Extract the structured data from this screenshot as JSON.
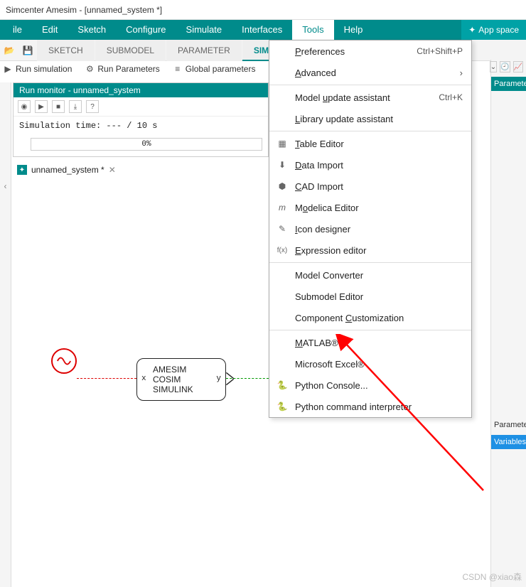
{
  "title": "Simcenter Amesim - [unnamed_system *]",
  "menubar": {
    "items": [
      "ile",
      "Edit",
      "Sketch",
      "Configure",
      "Simulate",
      "Interfaces",
      "Tools",
      "Help"
    ],
    "selected": "Tools",
    "app_space_label": "App space"
  },
  "toolbar": {
    "tabs": [
      "SKETCH",
      "SUBMODEL",
      "PARAMETER",
      "SIM"
    ],
    "active_tab": "SIM"
  },
  "subtoolbar": {
    "run_sim": "Run simulation",
    "run_params": "Run Parameters",
    "global_params": "Global parameters"
  },
  "right_panel": {
    "tab1": "Parameters",
    "tab_light": "Parameters",
    "tab_blue": "Variables"
  },
  "run_monitor": {
    "title": "Run monitor - unnamed_system",
    "sim_time": "Simulation time: --- / 10 s",
    "progress": "0%"
  },
  "document": {
    "name": "unnamed_system *",
    "close": "✕"
  },
  "block": {
    "port_in": "x",
    "port_out": "y",
    "line1": "AMESIM",
    "line2": "COSIM",
    "line3": "SIMULINK"
  },
  "tools_menu": {
    "preferences": "Preferences",
    "preferences_key": "Ctrl+Shift+P",
    "advanced": "Advanced",
    "model_update": "Model update assistant",
    "model_update_key": "Ctrl+K",
    "lib_update": "Library update assistant",
    "table_editor": "Table Editor",
    "data_import": "Data Import",
    "cad_import": "CAD Import",
    "modelica": "Modelica Editor",
    "icon_designer": "Icon designer",
    "expression": "Expression editor",
    "model_converter": "Model Converter",
    "submodel_editor": "Submodel Editor",
    "component_customization": "Component Customization",
    "matlab": "MATLAB®",
    "excel": "Microsoft Excel®",
    "python_console": "Python Console...",
    "python_cmd": "Python command interpreter"
  },
  "watermark": "CSDN @xiao森"
}
